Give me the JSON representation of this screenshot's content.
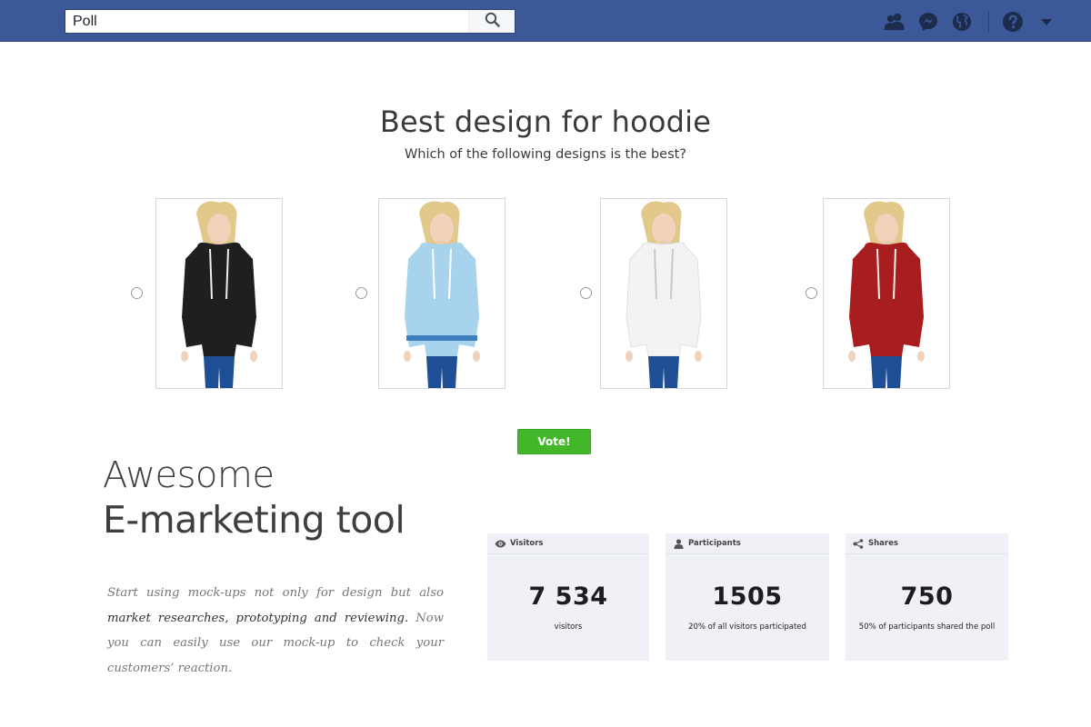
{
  "search": {
    "value": "Poll"
  },
  "poll": {
    "title": "Best design for hoodie",
    "subtitle": "Which of the following designs is the best?",
    "options": [
      {
        "color": "black",
        "hoodie_hex": "#1f1f1f"
      },
      {
        "color": "light-blue",
        "hoodie_hex": "#a8d3ec"
      },
      {
        "color": "white",
        "hoodie_hex": "#f3f3f3"
      },
      {
        "color": "red",
        "hoodie_hex": "#a81d1d"
      }
    ],
    "vote_label": "Vote!"
  },
  "marketing": {
    "line1": "Awesome",
    "line2": "E-marketing tool",
    "desc_part1": "Start using mock-ups not only for design but also ",
    "desc_bold": "market researches, prototyping and reviewing.",
    "desc_part2": " Now you can easily use our mock-up to check your customers’ reaction."
  },
  "stats": [
    {
      "label": "Visitors",
      "icon": "eye-icon",
      "value": "7 534",
      "caption": "visitors"
    },
    {
      "label": "Participants",
      "icon": "user-icon",
      "value": "1505",
      "caption": "20% of all visitors participated"
    },
    {
      "label": "Shares",
      "icon": "share-icon",
      "value": "750",
      "caption": "50% of participants shared the poll"
    }
  ],
  "colors": {
    "topbar": "#3b5998",
    "vote": "#42b72a",
    "stat_bg": "#f0f1f6"
  }
}
